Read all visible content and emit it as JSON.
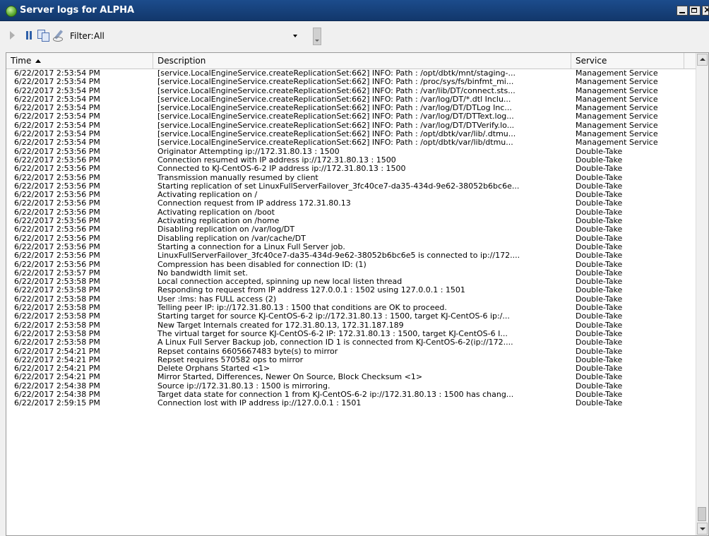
{
  "window": {
    "title": "Server logs for ALPHA"
  },
  "toolbar": {
    "filter_label": "Filter:",
    "filter_value": "All"
  },
  "columns": {
    "time": "Time",
    "description": "Description",
    "service": "Service"
  },
  "rows": [
    {
      "time": "6/22/2017 2:53:54 PM",
      "description": "[service.LocalEngineService.createReplicationSet:662] INFO: Path : /opt/dbtk/mnt/staging-...",
      "service": "Management Service"
    },
    {
      "time": "6/22/2017 2:53:54 PM",
      "description": "[service.LocalEngineService.createReplicationSet:662] INFO: Path : /proc/sys/fs/binfmt_mi...",
      "service": "Management Service"
    },
    {
      "time": "6/22/2017 2:53:54 PM",
      "description": "[service.LocalEngineService.createReplicationSet:662] INFO: Path : /var/lib/DT/connect.sts...",
      "service": "Management Service"
    },
    {
      "time": "6/22/2017 2:53:54 PM",
      "description": "[service.LocalEngineService.createReplicationSet:662] INFO: Path : /var/log/DT/*.dtl  Inclu...",
      "service": "Management Service"
    },
    {
      "time": "6/22/2017 2:53:54 PM",
      "description": "[service.LocalEngineService.createReplicationSet:662] INFO: Path : /var/log/DT/DTLog  Inc...",
      "service": "Management Service"
    },
    {
      "time": "6/22/2017 2:53:54 PM",
      "description": "[service.LocalEngineService.createReplicationSet:662] INFO: Path : /var/log/DT/DTText.log...",
      "service": "Management Service"
    },
    {
      "time": "6/22/2017 2:53:54 PM",
      "description": "[service.LocalEngineService.createReplicationSet:662] INFO: Path : /var/log/DT/DTVerify.lo...",
      "service": "Management Service"
    },
    {
      "time": "6/22/2017 2:53:54 PM",
      "description": "[service.LocalEngineService.createReplicationSet:662] INFO: Path : /opt/dbtk/var/lib/.dtmu...",
      "service": "Management Service"
    },
    {
      "time": "6/22/2017 2:53:54 PM",
      "description": "[service.LocalEngineService.createReplicationSet:662] INFO: Path : /opt/dbtk/var/lib/dtmu...",
      "service": "Management Service"
    },
    {
      "time": "6/22/2017 2:53:56 PM",
      "description": "Originator Attempting ip://172.31.80.13 : 1500",
      "service": "Double-Take"
    },
    {
      "time": "6/22/2017 2:53:56 PM",
      "description": "Connection resumed with IP address ip://172.31.80.13 : 1500",
      "service": "Double-Take"
    },
    {
      "time": "6/22/2017 2:53:56 PM",
      "description": "Connected to KJ-CentOS-6-2 IP address ip://172.31.80.13 : 1500",
      "service": "Double-Take"
    },
    {
      "time": "6/22/2017 2:53:56 PM",
      "description": "Transmission manually resumed by client",
      "service": "Double-Take"
    },
    {
      "time": "6/22/2017 2:53:56 PM",
      "description": "Starting replication of set LinuxFullServerFailover_3fc40ce7-da35-434d-9e62-38052b6bc6e...",
      "service": "Double-Take"
    },
    {
      "time": "6/22/2017 2:53:56 PM",
      "description": "Activating replication on /",
      "service": "Double-Take"
    },
    {
      "time": "6/22/2017 2:53:56 PM",
      "description": "Connection request from IP address 172.31.80.13",
      "service": "Double-Take"
    },
    {
      "time": "6/22/2017 2:53:56 PM",
      "description": "Activating replication on /boot",
      "service": "Double-Take"
    },
    {
      "time": "6/22/2017 2:53:56 PM",
      "description": "Activating replication on /home",
      "service": "Double-Take"
    },
    {
      "time": "6/22/2017 2:53:56 PM",
      "description": "Disabling replication on /var/log/DT",
      "service": "Double-Take"
    },
    {
      "time": "6/22/2017 2:53:56 PM",
      "description": "Disabling replication on /var/cache/DT",
      "service": "Double-Take"
    },
    {
      "time": "6/22/2017 2:53:56 PM",
      "description": "Starting a connection for a Linux Full Server job.",
      "service": "Double-Take"
    },
    {
      "time": "6/22/2017 2:53:56 PM",
      "description": "LinuxFullServerFailover_3fc40ce7-da35-434d-9e62-38052b6bc6e5 is connected to ip://172....",
      "service": "Double-Take"
    },
    {
      "time": "6/22/2017 2:53:56 PM",
      "description": "Compression has been disabled for connection ID: (1)",
      "service": "Double-Take"
    },
    {
      "time": "6/22/2017 2:53:57 PM",
      "description": "No bandwidth limit set.",
      "service": "Double-Take"
    },
    {
      "time": "6/22/2017 2:53:58 PM",
      "description": "Local connection accepted, spinning up new local listen thread",
      "service": "Double-Take"
    },
    {
      "time": "6/22/2017 2:53:58 PM",
      "description": "Responding to request from IP address 127.0.0.1 : 1502 using 127.0.0.1 : 1501",
      "service": "Double-Take"
    },
    {
      "time": "6/22/2017 2:53:58 PM",
      "description": "User :lms: has FULL access (2)",
      "service": "Double-Take"
    },
    {
      "time": "6/22/2017 2:53:58 PM",
      "description": "Telling peer IP: ip://172.31.80.13 : 1500 that conditions are OK to proceed.",
      "service": "Double-Take"
    },
    {
      "time": "6/22/2017 2:53:58 PM",
      "description": "Starting target for source KJ-CentOS-6-2 ip://172.31.80.13 : 1500, target KJ-CentOS-6 ip:/...",
      "service": "Double-Take"
    },
    {
      "time": "6/22/2017 2:53:58 PM",
      "description": "New Target Internals created for 172.31.80.13, 172.31.187.189",
      "service": "Double-Take"
    },
    {
      "time": "6/22/2017 2:53:58 PM",
      "description": "The virtual target for source KJ-CentOS-6-2 IP: 172.31.80.13 : 1500, target KJ-CentOS-6 I...",
      "service": "Double-Take"
    },
    {
      "time": "6/22/2017 2:53:58 PM",
      "description": "A Linux Full Server Backup job, connection ID 1 is connected from KJ-CentOS-6-2(ip://172....",
      "service": "Double-Take"
    },
    {
      "time": "6/22/2017 2:54:21 PM",
      "description": "Repset contains 6605667483 byte(s) to mirror",
      "service": "Double-Take"
    },
    {
      "time": "6/22/2017 2:54:21 PM",
      "description": "Repset requires 570582 ops to mirror",
      "service": "Double-Take"
    },
    {
      "time": "6/22/2017 2:54:21 PM",
      "description": "Delete Orphans Started <1>",
      "service": "Double-Take"
    },
    {
      "time": "6/22/2017 2:54:21 PM",
      "description": "Mirror Started, Differences, Newer On Source, Block Checksum <1>",
      "service": "Double-Take"
    },
    {
      "time": "6/22/2017 2:54:38 PM",
      "description": "Source ip://172.31.80.13 : 1500 is mirroring.",
      "service": "Double-Take"
    },
    {
      "time": "6/22/2017 2:54:38 PM",
      "description": "Target data state for connection 1 from KJ-CentOS-6-2 ip://172.31.80.13 : 1500 has chang...",
      "service": "Double-Take"
    },
    {
      "time": "6/22/2017 2:59:15 PM",
      "description": "Connection lost with IP address ip://127.0.0.1 : 1501",
      "service": "Double-Take"
    }
  ]
}
